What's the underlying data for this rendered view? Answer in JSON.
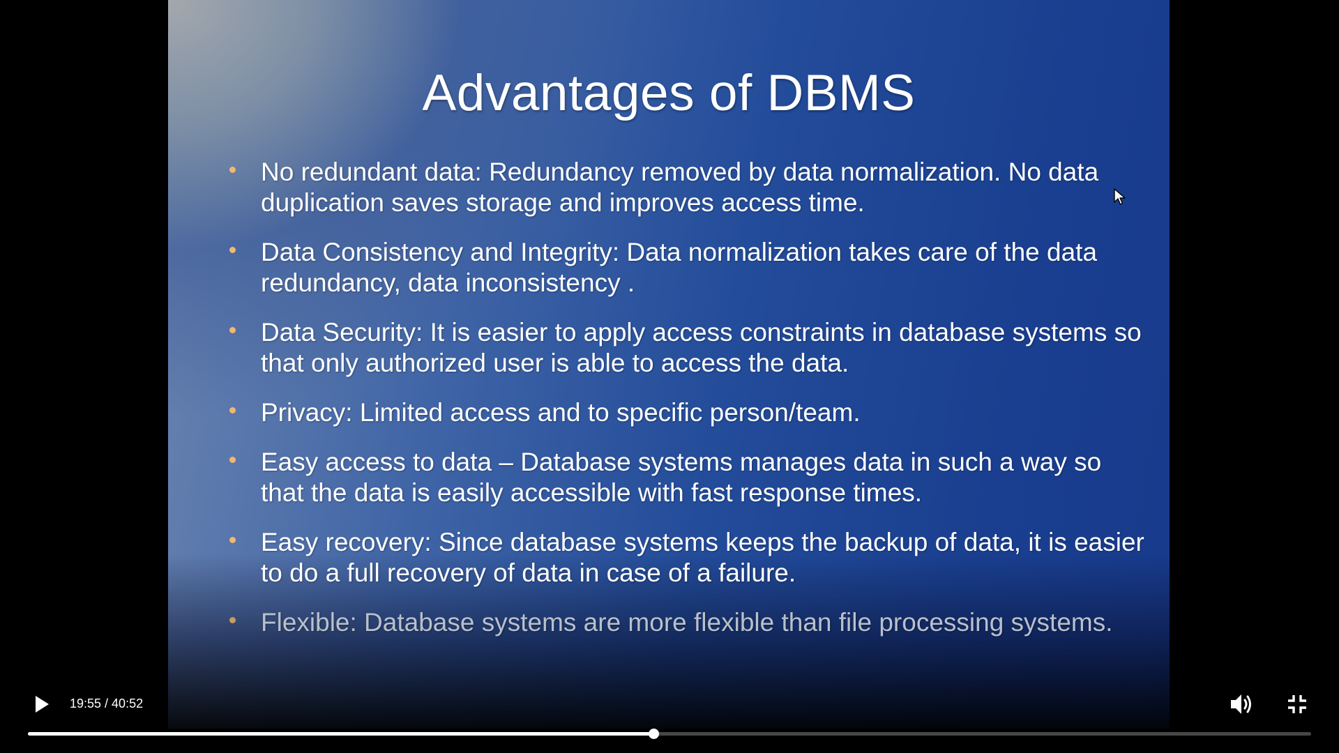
{
  "slide": {
    "title": "Advantages of DBMS",
    "bullets": [
      {
        "text": "No redundant data: Redundancy removed by data normalization. No data duplication saves storage and improves access time.",
        "faded": false
      },
      {
        "text": "Data Consistency and Integrity: Data normalization takes care of the data redundancy, data inconsistency .",
        "faded": false
      },
      {
        "text": "Data Security: It is easier to apply access constraints in database systems so that only authorized user is able to access the data.",
        "faded": false
      },
      {
        "text": "Privacy: Limited access and to specific person/team.",
        "faded": false
      },
      {
        "text": "Easy access to data – Database systems manages data in such a way so that the data is easily accessible with fast response times.",
        "faded": false
      },
      {
        "text": "Easy recovery: Since database systems keeps the backup of data, it is easier to do a full recovery of data in case of a failure.",
        "faded": false
      },
      {
        "text": "Flexible: Database systems are more flexible than file processing systems.",
        "faded": true
      }
    ]
  },
  "player": {
    "time_display": "19:55 / 40:52",
    "progress_fraction": 0.4874,
    "icons": {
      "play": "play-icon",
      "volume": "volume-icon",
      "fullscreen_exit": "fullscreen-exit-icon",
      "cursor": "mouse-cursor-icon"
    },
    "colors": {
      "bullet_accent": "#f2b870",
      "progress": "#ffffff",
      "background": "#000000"
    }
  }
}
